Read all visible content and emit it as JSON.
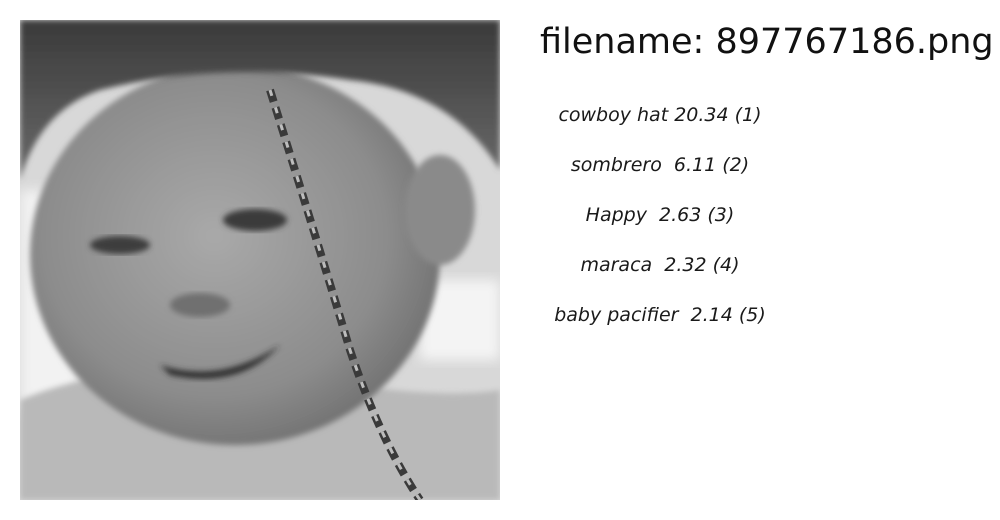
{
  "filename_label": "filename: 897767186.png",
  "image": {
    "icon": "photo-of-smiling-baby-in-straw-hat",
    "tint": "#808080"
  },
  "predictions": [
    {
      "text": "cowboy hat 20.34 (1)"
    },
    {
      "text": "sombrero  6.11 (2)"
    },
    {
      "text": "Happy  2.63 (3)"
    },
    {
      "text": "maraca  2.32 (4)"
    },
    {
      "text": "baby pacifier  2.14 (5)"
    }
  ]
}
